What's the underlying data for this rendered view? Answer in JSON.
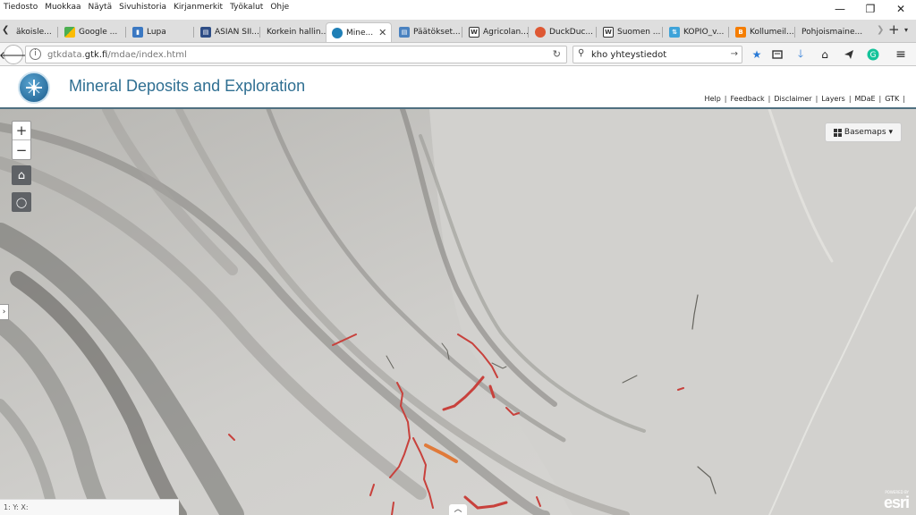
{
  "menu": {
    "items": [
      "Tiedosto",
      "Muokkaa",
      "Näytä",
      "Sivuhistoria",
      "Kirjanmerkit",
      "Työkalut",
      "Ohje"
    ]
  },
  "window_controls": {
    "minimize": "—",
    "restore": "❐",
    "close": "✕"
  },
  "tabs": [
    {
      "label": "äkoisle...",
      "icon": "doc-icon",
      "color": "#bbbbbb"
    },
    {
      "label": "Google ...",
      "icon": "google-maps-icon",
      "color": "#4caf50"
    },
    {
      "label": "Lupa",
      "icon": "chart-icon",
      "color": "#3b78c2"
    },
    {
      "label": "ASIAN SII...",
      "icon": "doc-icon",
      "color": "#2e4d86"
    },
    {
      "label": "Korkein hallin...",
      "icon": "none",
      "color": "#dedede"
    },
    {
      "label": "Mine...",
      "icon": "globe-icon",
      "color": "#1f7fb6",
      "active": true
    },
    {
      "label": "Päätökset...",
      "icon": "doc-icon",
      "color": "#4a82c0"
    },
    {
      "label": "Agricolan...",
      "icon": "w-icon",
      "color": "#333333"
    },
    {
      "label": "DuckDuc...",
      "icon": "duckduckgo-icon",
      "color": "#de5833"
    },
    {
      "label": "Suomen ...",
      "icon": "w-icon",
      "color": "#333333"
    },
    {
      "label": "KOPIO_v...",
      "icon": "drive-icon",
      "color": "#3ea3d9"
    },
    {
      "label": "Kollumeil...",
      "icon": "blogger-icon",
      "color": "#f57d00"
    },
    {
      "label": "Pohjoismaine...",
      "icon": "none",
      "color": "#dedede"
    }
  ],
  "tab_close": "✕",
  "tabstrip": {
    "new_tab": "+",
    "scroll_left": "❮",
    "scroll_right": "❯",
    "list": "▾"
  },
  "navbar": {
    "url_plain": "gtkdata.",
    "url_domain": "gtk.fi",
    "url_path": "/mdae/index.html",
    "info": "i",
    "reload": "↻",
    "search_text": "kho yhteystiedot",
    "search_go": "→"
  },
  "app": {
    "title": "Mineral Deposits and Exploration",
    "links": [
      "Help",
      "Feedback",
      "Disclaimer",
      "Layers",
      "MDaE",
      "GTK"
    ],
    "link_sep": "|"
  },
  "map": {
    "zoom_in": "+",
    "zoom_out": "−",
    "home": "⌂",
    "locate": "◯",
    "basemaps_label": "Basemaps",
    "basemaps_caret": "▾",
    "side_toggle": "›",
    "coords": "1:  Y:  X:",
    "bottom_toggle": "︿",
    "esri_small": "POWERED BY",
    "esri_big": "esri"
  },
  "colors": {
    "title": "#2f6f92",
    "deposit_red": "#c8413c",
    "deposit_orange": "#e07a3a",
    "control_bg": "#5f6266"
  }
}
